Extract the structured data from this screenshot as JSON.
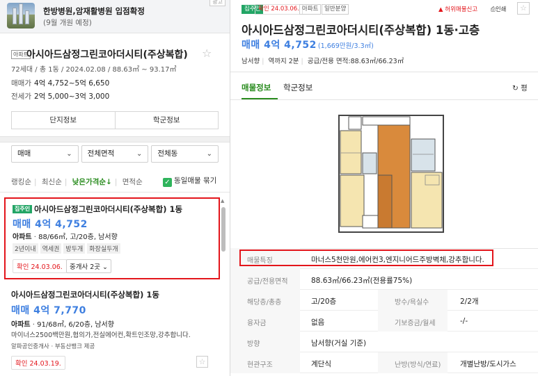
{
  "banner": {
    "title": "한방병원,암재활병원 입점확정",
    "subtitle": "(9월 개원 예정)",
    "ad_label": "광고"
  },
  "complex": {
    "type_tag": "아파트",
    "name": "아시아드삼정그린코아더시티(주상복합)",
    "info": "72세대 / 총 1동 / 2024.02.08 / 88.63㎡ ~ 93.17㎡",
    "sale_label": "매매가",
    "sale_value": "4억 4,752~5억 6,650",
    "jeonse_label": "전세가",
    "jeonse_value": "2억 5,000~3억 3,000",
    "tab_danji": "단지정보",
    "tab_school": "학군정보"
  },
  "filters": [
    "매매",
    "전체면적",
    "전체동"
  ],
  "sort": {
    "options": [
      "랭킹순",
      "최신순",
      "낮은가격순↓",
      "면적순"
    ],
    "active_index": 2,
    "group_label": "동일매물 묶기",
    "group_checked": true
  },
  "listings": [
    {
      "badge": "집주인",
      "name": "아시아드삼정그린코아더시티(주상복합) 1동",
      "price": "매매 4억 4,752",
      "spec_type": "아파트",
      "spec": "88/66㎡, 고/20층, 남서향",
      "tags": [
        "2년이내",
        "역세권",
        "방두개",
        "화장실두개"
      ],
      "confirm": "확인 24.03.06.",
      "agents": "중개사 2곳 ⌄",
      "highlighted": true
    },
    {
      "name": "아시아드삼정그린코아더시티(주상복합) 1동",
      "price": "매매 4억 7,770",
      "spec_type": "아파트",
      "spec": "91/68㎡, 6/20층, 남서향",
      "desc": "마이너스2500백만원,협의가,전실에어컨,확트인조망,강추합니다.",
      "source": "알파공인중개사 · 부동산뱅크 제공",
      "confirm": "확인 24.03.19."
    }
  ],
  "detail": {
    "badge": "집주인",
    "confirm": "확인 24.03.06.",
    "chips": [
      "아파트",
      "일반분양"
    ],
    "report": "허위매물신고",
    "print": "인쇄",
    "title": "아시아드삼정그린코아더시티(주상복합) 1동·고층",
    "price": "매매 4억 4,752",
    "price_unit": "(1,669만원/3.3㎡)",
    "meta": [
      "남서향",
      "역까지 2분",
      "공급/전용 면적:88.63㎡/66.23㎡"
    ],
    "tabs": [
      "매물정보",
      "학군정보"
    ],
    "refresh": "평",
    "rows": [
      {
        "k": "매물특징",
        "v": "마너스5천만원,에어컨3,엔지니어드주방벽체,강추합니다."
      },
      {
        "k": "공급/전용면적",
        "v": "88.63㎡/66.23㎡(전용률75%)"
      },
      {
        "k": "해당층/총층",
        "v": "고/20층",
        "k2": "방수/욕실수",
        "v2": "2/2개"
      },
      {
        "k": "융자금",
        "v": "없음",
        "k2": "기보증금/월세",
        "v2": "-/-"
      },
      {
        "k": "방향",
        "v": "남서향(거실 기준)"
      },
      {
        "k": "현관구조",
        "v": "계단식",
        "k2": "난방(방식/연료)",
        "v2": "개별난방/도시가스"
      }
    ]
  },
  "colors": {
    "brand_green": "#22a565",
    "price_blue": "#3e7fe0",
    "highlight_red": "#e3151b"
  }
}
